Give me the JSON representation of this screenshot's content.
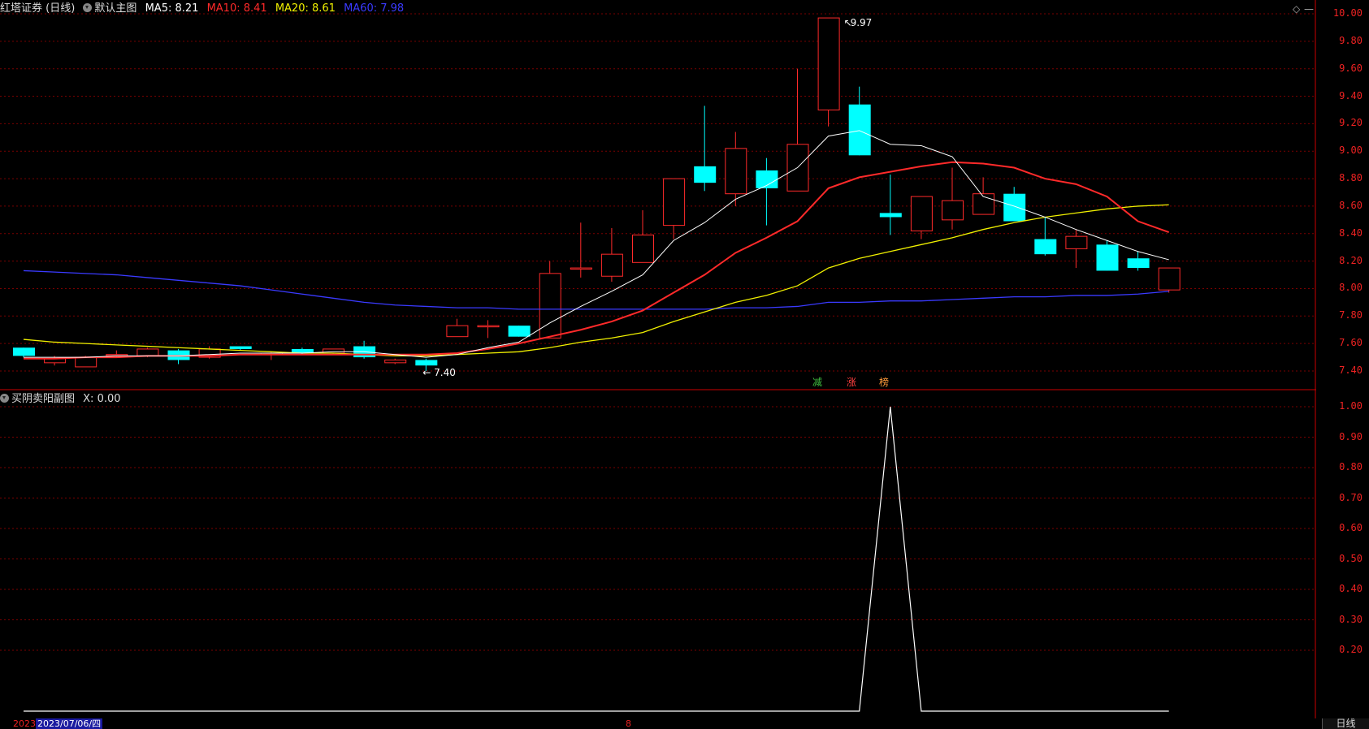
{
  "header": {
    "broker": "红塔证券 (日线)",
    "template": "默认主图",
    "ma5_label": "MA5: 8.21",
    "ma10_label": "MA10: 8.41",
    "ma20_label": "MA20: 8.61",
    "ma60_label": "MA60: 7.98",
    "colors": {
      "ma5": "#ffffff",
      "ma10": "#ff2a2a",
      "ma20": "#f0f000",
      "ma60": "#3a3aff"
    }
  },
  "sub_header": {
    "indicator": "买阴卖阳副图",
    "value_label": "X: 0.00"
  },
  "markers": {
    "high": "9.97",
    "low": "7.40"
  },
  "tags": [
    {
      "text": "减",
      "color": "#40c040"
    },
    {
      "text": "涨",
      "color": "#ff4040"
    },
    {
      "text": "榜",
      "color": "#ff9a3a"
    }
  ],
  "footer": {
    "year_stub": "2023",
    "date": "2023/07/06/四",
    "mid_mark": "8",
    "period_tab": "日线"
  },
  "chart_data": [
    {
      "type": "candlestick",
      "title": "",
      "ylim": [
        7.3,
        10.05
      ],
      "y_ticks": [
        "10.00",
        "9.80",
        "9.60",
        "9.40",
        "9.20",
        "9.00",
        "8.80",
        "8.60",
        "8.40",
        "8.20",
        "8.00",
        "7.80",
        "7.60",
        "7.40"
      ],
      "up_color": "#ff2a2a",
      "down_color": "#00ffff",
      "candles": [
        [
          7.57,
          7.51,
          7.57,
          7.5
        ],
        [
          7.46,
          7.49,
          7.51,
          7.44
        ],
        [
          7.43,
          7.5,
          7.51,
          7.43
        ],
        [
          7.52,
          7.52,
          7.55,
          7.5
        ],
        [
          7.51,
          7.56,
          7.57,
          7.5
        ],
        [
          7.55,
          7.48,
          7.56,
          7.45
        ],
        [
          7.5,
          7.56,
          7.58,
          7.49
        ],
        [
          7.58,
          7.56,
          7.58,
          7.55
        ],
        [
          7.53,
          7.53,
          7.54,
          7.48
        ],
        [
          7.56,
          7.53,
          7.57,
          7.52
        ],
        [
          7.53,
          7.56,
          7.56,
          7.52
        ],
        [
          7.58,
          7.5,
          7.62,
          7.49
        ],
        [
          7.46,
          7.48,
          7.49,
          7.45
        ],
        [
          7.48,
          7.44,
          7.49,
          7.4
        ],
        [
          7.65,
          7.73,
          7.78,
          7.65
        ],
        [
          7.73,
          7.73,
          7.77,
          7.64
        ],
        [
          7.73,
          7.65,
          7.73,
          7.65
        ],
        [
          7.64,
          8.11,
          8.2,
          7.64
        ],
        [
          8.15,
          8.15,
          8.48,
          8.08
        ],
        [
          8.09,
          8.25,
          8.44,
          8.05
        ],
        [
          8.19,
          8.39,
          8.57,
          8.19
        ],
        [
          8.46,
          8.8,
          8.8,
          8.36
        ],
        [
          8.89,
          8.77,
          9.33,
          8.71
        ],
        [
          8.69,
          9.02,
          9.14,
          8.6
        ],
        [
          8.86,
          8.73,
          8.95,
          8.46
        ],
        [
          8.71,
          9.05,
          9.6,
          8.71
        ],
        [
          9.3,
          9.97,
          9.97,
          9.18
        ],
        [
          9.34,
          8.97,
          9.47,
          8.97
        ],
        [
          8.55,
          8.52,
          8.83,
          8.39
        ],
        [
          8.42,
          8.67,
          8.67,
          8.36
        ],
        [
          8.5,
          8.64,
          8.88,
          8.43
        ],
        [
          8.54,
          8.69,
          8.81,
          8.54
        ],
        [
          8.69,
          8.49,
          8.74,
          8.49
        ],
        [
          8.36,
          8.25,
          8.52,
          8.24
        ],
        [
          8.29,
          8.38,
          8.43,
          8.15
        ],
        [
          8.32,
          8.13,
          8.35,
          8.13
        ],
        [
          8.22,
          8.15,
          8.27,
          8.13
        ],
        [
          7.99,
          8.15,
          8.15,
          7.97
        ]
      ],
      "ma5": [
        7.5,
        7.5,
        7.5,
        7.51,
        7.51,
        7.51,
        7.52,
        7.53,
        7.53,
        7.53,
        7.54,
        7.54,
        7.52,
        7.5,
        7.52,
        7.57,
        7.61,
        7.75,
        7.87,
        7.98,
        8.1,
        8.35,
        8.48,
        8.65,
        8.75,
        8.88,
        9.11,
        9.15,
        9.05,
        9.04,
        8.96,
        8.67,
        8.6,
        8.52,
        8.43,
        8.35,
        8.27,
        8.21
      ],
      "ma10": [
        7.49,
        7.49,
        7.5,
        7.5,
        7.51,
        7.51,
        7.51,
        7.52,
        7.52,
        7.52,
        7.52,
        7.52,
        7.52,
        7.52,
        7.53,
        7.56,
        7.6,
        7.65,
        7.7,
        7.76,
        7.84,
        7.97,
        8.1,
        8.26,
        8.37,
        8.49,
        8.73,
        8.81,
        8.85,
        8.89,
        8.92,
        8.91,
        8.88,
        8.8,
        8.76,
        8.67,
        8.49,
        8.41
      ],
      "ma20": [
        7.63,
        7.61,
        7.6,
        7.59,
        7.58,
        7.57,
        7.56,
        7.55,
        7.54,
        7.53,
        7.53,
        7.52,
        7.51,
        7.51,
        7.52,
        7.53,
        7.54,
        7.57,
        7.61,
        7.64,
        7.68,
        7.76,
        7.83,
        7.9,
        7.95,
        8.02,
        8.15,
        8.22,
        8.27,
        8.32,
        8.37,
        8.43,
        8.48,
        8.52,
        8.55,
        8.58,
        8.6,
        8.61
      ],
      "ma60": [
        8.13,
        8.12,
        8.11,
        8.1,
        8.08,
        8.06,
        8.04,
        8.02,
        7.99,
        7.96,
        7.93,
        7.9,
        7.88,
        7.87,
        7.86,
        7.86,
        7.85,
        7.85,
        7.85,
        7.85,
        7.85,
        7.85,
        7.85,
        7.86,
        7.86,
        7.87,
        7.9,
        7.9,
        7.91,
        7.91,
        7.92,
        7.93,
        7.94,
        7.94,
        7.95,
        7.95,
        7.96,
        7.98
      ]
    },
    {
      "type": "line",
      "title": "买阴卖阳副图",
      "ylim": [
        0,
        1.06
      ],
      "y_ticks": [
        "1.00",
        "0.90",
        "0.80",
        "0.70",
        "0.60",
        "0.50",
        "0.40",
        "0.30",
        "0.20"
      ],
      "series": [
        {
          "color": "#ffffff",
          "values": [
            0,
            0,
            0,
            0,
            0,
            0,
            0,
            0,
            0,
            0,
            0,
            0,
            0,
            0,
            0,
            0,
            0,
            0,
            0,
            0,
            0,
            0,
            0,
            0,
            0,
            0,
            0,
            0,
            1,
            0,
            0,
            0,
            0,
            0,
            0,
            0,
            0,
            0
          ]
        }
      ]
    }
  ]
}
